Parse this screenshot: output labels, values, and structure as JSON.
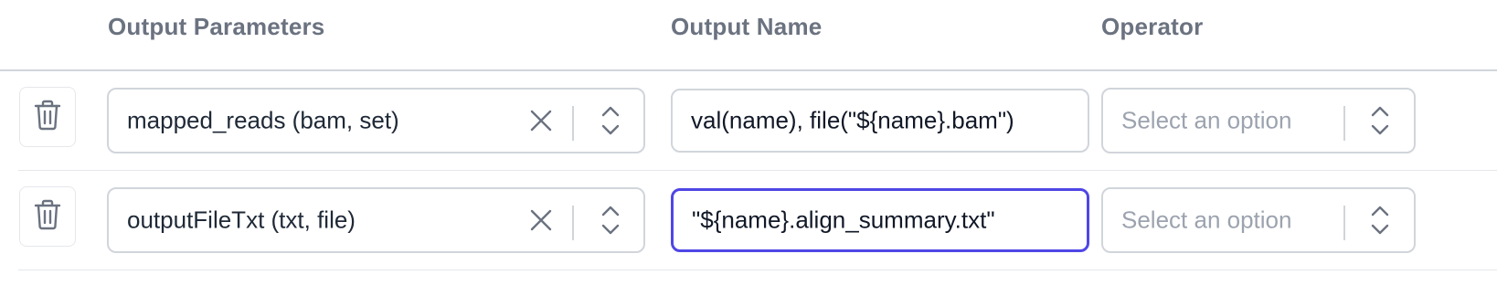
{
  "headers": {
    "output_parameters": "Output Parameters",
    "output_name": "Output Name",
    "operator": "Operator"
  },
  "rows": [
    {
      "parameter": "mapped_reads (bam, set)",
      "output_name": "val(name), file(\"${name}.bam\")",
      "operator_placeholder": "Select an option",
      "focused": false
    },
    {
      "parameter": "outputFileTxt (txt, file)",
      "output_name": "\"${name}.align_summary.txt\"",
      "operator_placeholder": "Select an option",
      "focused": true
    }
  ],
  "icons": {
    "delete": "trash-icon",
    "clear": "close-icon",
    "dropdown": "chevron-up-down-icon"
  },
  "colors": {
    "focus_ring": "#4f46e5",
    "header_text": "#6b7280",
    "border": "#d1d5db",
    "placeholder": "#9ca3af"
  }
}
